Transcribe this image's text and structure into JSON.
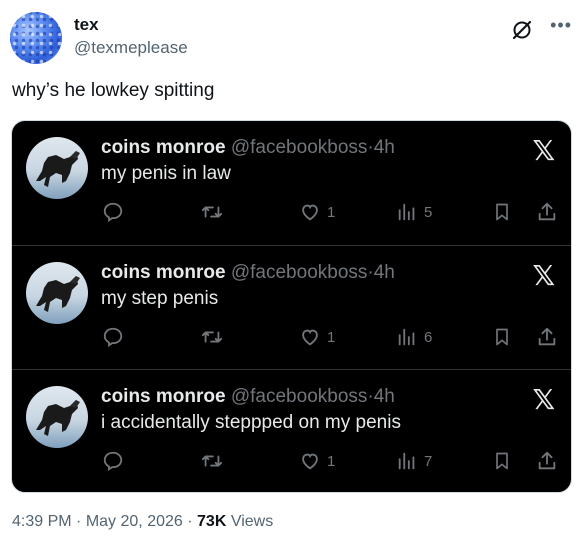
{
  "post": {
    "author_name": "tex",
    "author_handle": "@texmeplease",
    "text": "why’s he lowkey spitting"
  },
  "quoted_posts": [
    {
      "name": "coins monroe",
      "handle": "@facebookboss",
      "sep": "·",
      "time": "4h",
      "text": "my penis in law",
      "likes": "1",
      "views": "5"
    },
    {
      "name": "coins monroe",
      "handle": "@facebookboss",
      "sep": "·",
      "time": "4h",
      "text": "my step penis",
      "likes": "1",
      "views": "6"
    },
    {
      "name": "coins monroe",
      "handle": "@facebookboss",
      "sep": "·",
      "time": "4h",
      "text": "i accidentally steppped on my penis",
      "likes": "1",
      "views": "7"
    }
  ],
  "footer": {
    "time": "4:39 PM",
    "dot": "·",
    "date": "May 20, 2026",
    "views_count": "73K",
    "views_label": "Views"
  },
  "icons": {
    "more": "more-icon",
    "grok": "grok-icon",
    "x_logo": "x-logo-icon"
  },
  "colors": {
    "dark_bg": "#000000",
    "muted": "#536471"
  }
}
